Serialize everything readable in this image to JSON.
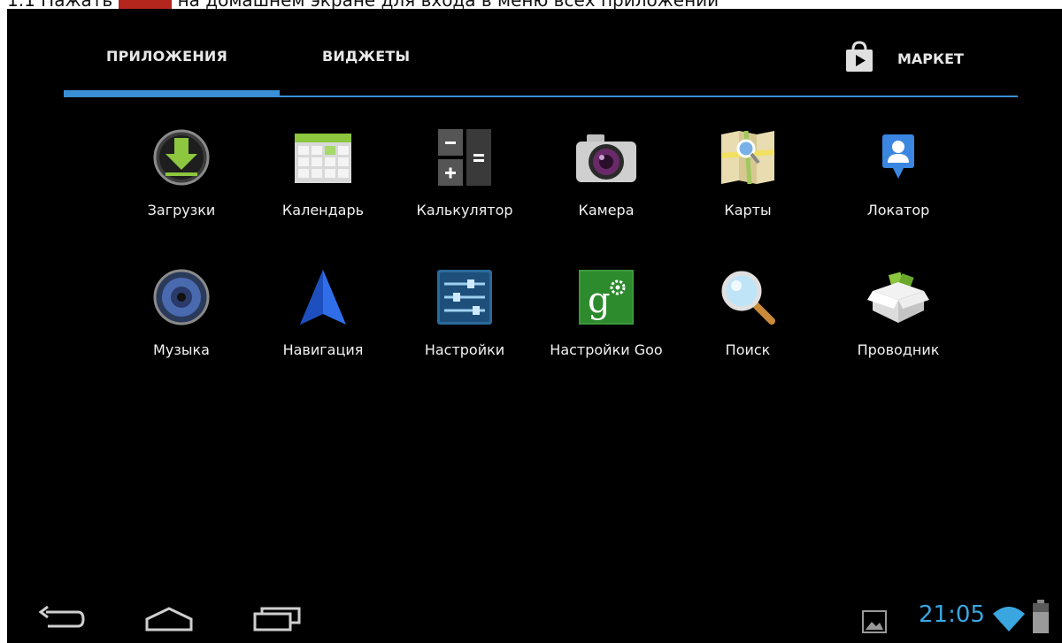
{
  "caption": {
    "prefix": "1.1 Нажать",
    "suffix": "на домашнем экране для входа в меню всех приложений"
  },
  "tabs": {
    "apps": "ПРИЛОЖЕНИЯ",
    "widgets": "ВИДЖЕТЫ",
    "market": "МАРКЕТ",
    "active": "apps"
  },
  "apps": [
    {
      "label": "Загрузки",
      "icon": "download-icon"
    },
    {
      "label": "Календарь",
      "icon": "calendar-icon"
    },
    {
      "label": "Калькулятор",
      "icon": "calculator-icon"
    },
    {
      "label": "Камера",
      "icon": "camera-icon"
    },
    {
      "label": "Карты",
      "icon": "maps-icon"
    },
    {
      "label": "Локатор",
      "icon": "locator-icon"
    },
    {
      "label": "Музыка",
      "icon": "music-icon"
    },
    {
      "label": "Навигация",
      "icon": "navigation-icon"
    },
    {
      "label": "Настройки",
      "icon": "settings-icon"
    },
    {
      "label": "Настройки Goo",
      "icon": "google-settings-icon"
    },
    {
      "label": "Поиск",
      "icon": "search-icon"
    },
    {
      "label": "Проводник",
      "icon": "file-explorer-icon"
    }
  ],
  "statusbar": {
    "time": "21:05"
  },
  "colors": {
    "accent": "#3a8fd6",
    "clock": "#3aa6e0",
    "background": "#000000"
  }
}
